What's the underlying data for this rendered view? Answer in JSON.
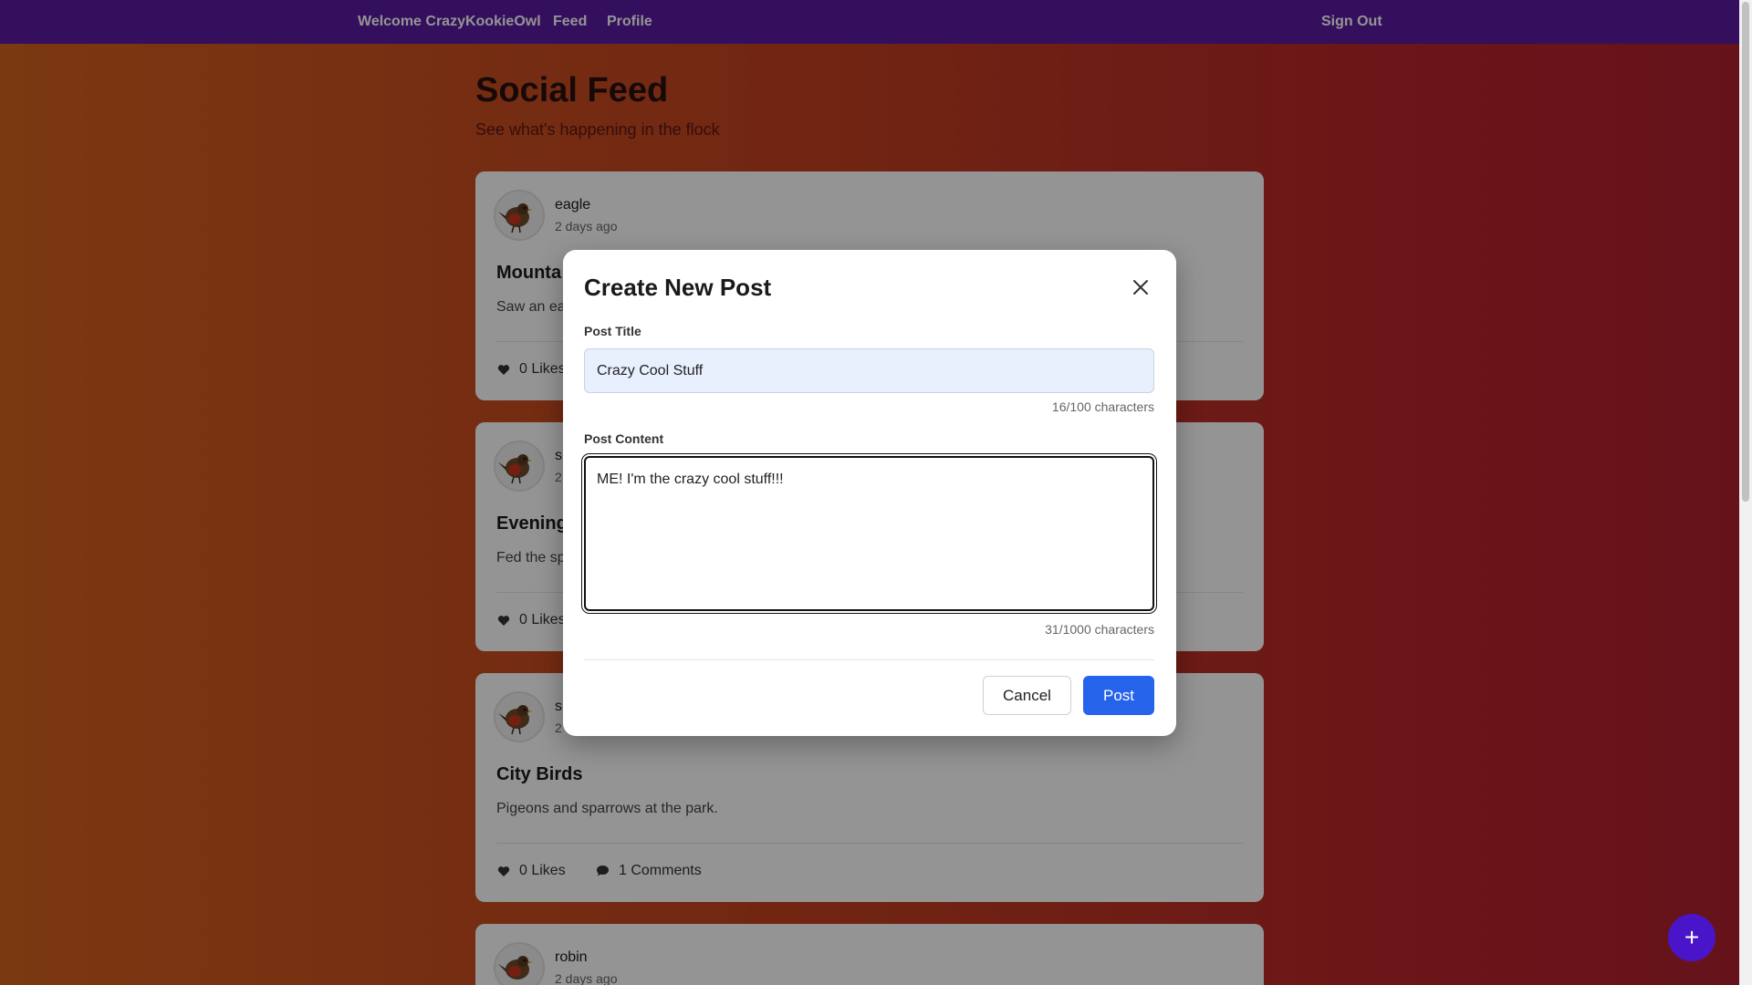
{
  "navbar": {
    "welcome": "Welcome CrazyKookieOwl",
    "feed": "Feed",
    "profile": "Profile",
    "sign_out": "Sign Out"
  },
  "page": {
    "title": "Social Feed",
    "subtitle": "See what's happening in the flock"
  },
  "posts": [
    {
      "user": "eagle",
      "time": "2 days ago",
      "title": "Mounta",
      "body": "Saw an ea",
      "likes": "0 Likes",
      "comments": ""
    },
    {
      "user": "s",
      "time": "2",
      "title": "Evening",
      "body": "Fed the sp",
      "likes": "0 Likes",
      "comments": ""
    },
    {
      "user": "s",
      "time": "2",
      "title": "City Birds",
      "body": "Pigeons and sparrows at the park.",
      "likes": "0 Likes",
      "comments": "1 Comments"
    },
    {
      "user": "robin",
      "time": "2 days ago",
      "title": "",
      "body": "",
      "likes": "",
      "comments": ""
    }
  ],
  "modal": {
    "title": "Create New Post",
    "post_title_label": "Post Title",
    "post_title_value": "Crazy Cool Stuff",
    "post_title_count": "16/100 characters",
    "post_content_label": "Post Content",
    "post_content_value": "ME! I'm the crazy cool stuff!!!",
    "post_content_count": "31/1000 characters",
    "cancel_label": "Cancel",
    "post_label": "Post"
  },
  "fab": {
    "icon": "plus-icon",
    "label": "+"
  },
  "colors": {
    "navbar": "#5a1aa0",
    "primary_button": "#2563eb",
    "fab": "#4a14c8"
  }
}
